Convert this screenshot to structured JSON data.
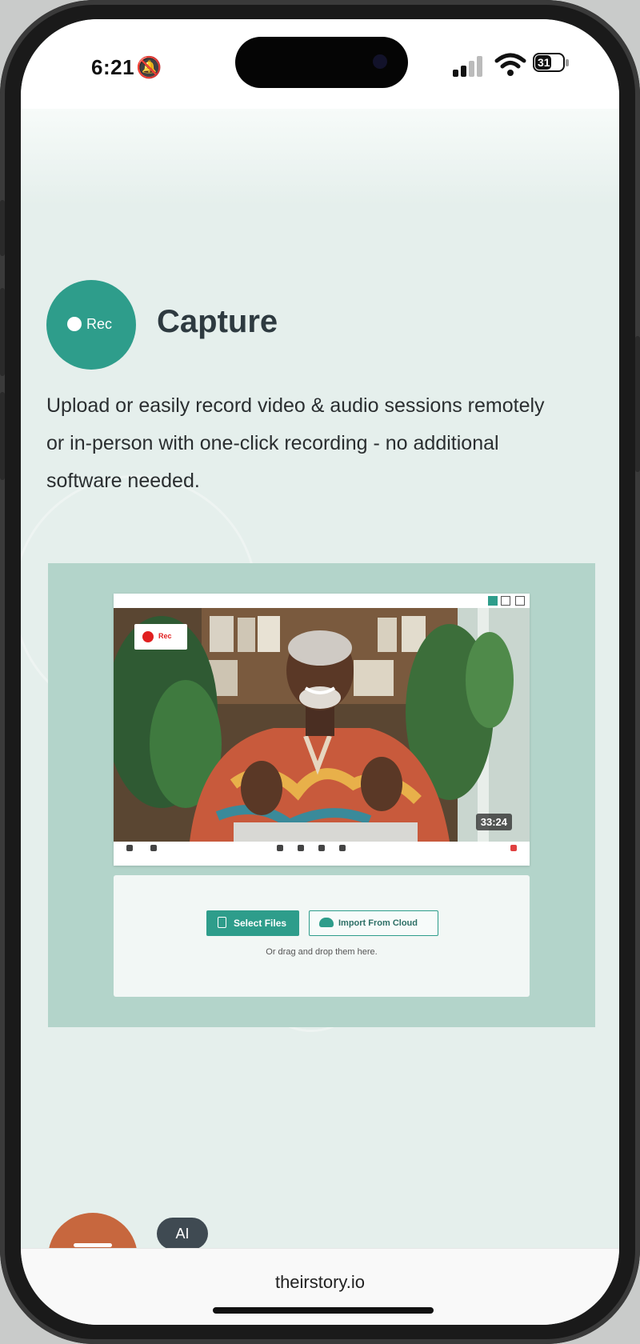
{
  "status_bar": {
    "time": "6:21",
    "battery": "31"
  },
  "feature": {
    "badge_label": "Rec",
    "title": "Capture",
    "description": "Upload or easily record video & audio sessions remotely or in-person with one-click recording - no additional software needed."
  },
  "preview": {
    "rec_label": "Rec",
    "timer": "33:24",
    "upload": {
      "select_files": "Select Files",
      "import_cloud": "Import From Cloud",
      "drag_hint": "Or drag and drop them here."
    }
  },
  "bottom": {
    "ai_label": "AI",
    "url": "theirstory.io"
  },
  "colors": {
    "accent": "#2e9d8b",
    "panel_bg": "#b3d4ca",
    "page_bg": "#e5efec",
    "orange": "#c7673e"
  }
}
